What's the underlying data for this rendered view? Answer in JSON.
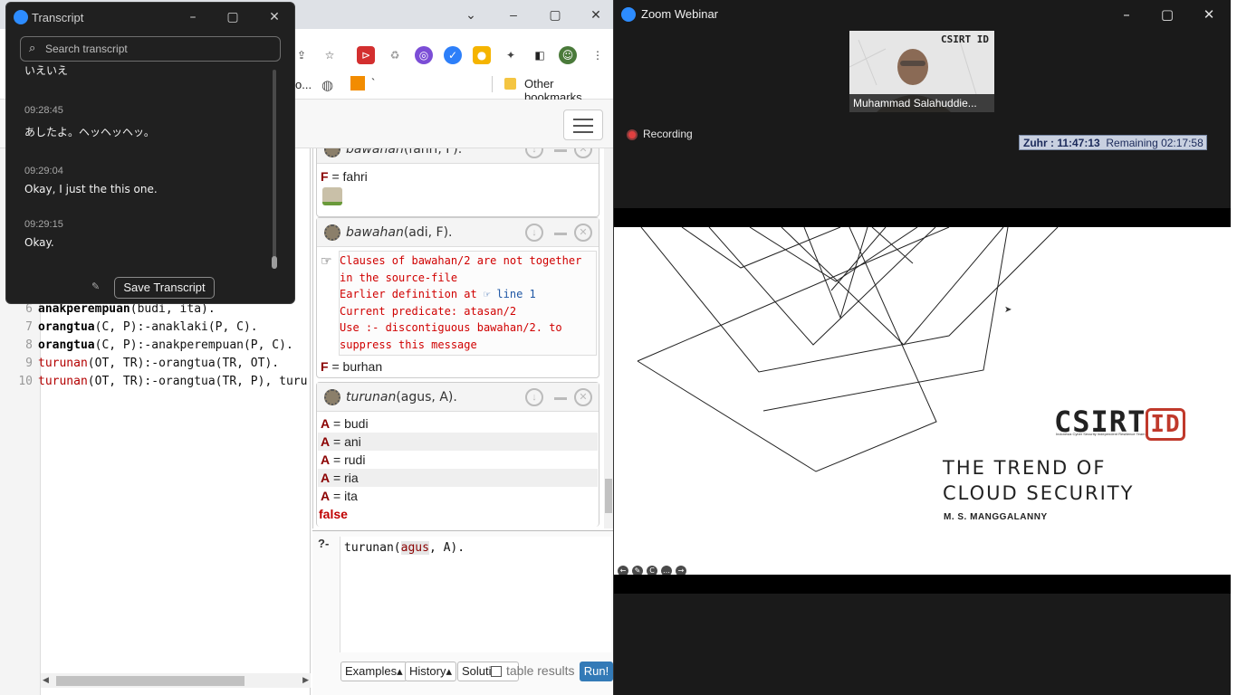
{
  "browser": {
    "bookmarks": {
      "truncated_label": "o...",
      "other_bookmarks": "Other bookmarks",
      "backtick": "`"
    },
    "editor": {
      "lines": [
        {
          "num": "6",
          "tokens": [
            [
              "kw",
              "anakperempuan"
            ],
            [
              "txt",
              "(budi, ita)."
            ]
          ]
        },
        {
          "num": "7",
          "tokens": [
            [
              "kw",
              "orangtua"
            ],
            [
              "txt",
              "(C, P):-anaklaki(P, C)."
            ]
          ]
        },
        {
          "num": "8",
          "tokens": [
            [
              "kw",
              "orangtua"
            ],
            [
              "txt",
              "(C, P):-anakperempuan(P, C)."
            ]
          ]
        },
        {
          "num": "9",
          "tokens": [
            [
              "red",
              "turunan"
            ],
            [
              "txt",
              "(OT, TR):-orangtua(TR, OT)."
            ]
          ]
        },
        {
          "num": "10",
          "tokens": [
            [
              "red",
              "turunan"
            ],
            [
              "txt",
              "(OT, TR):-orangtua(TR, P), turu"
            ]
          ]
        }
      ]
    },
    "results": {
      "q1": {
        "pred": "bawahan",
        "args": "(fahri, F).",
        "answer_var": "F",
        "answer_val": "fahri"
      },
      "q2": {
        "pred": "bawahan",
        "args": "(adi, F).",
        "warning": [
          "Clauses of bawahan/2 are not together in the source-file",
          "Earlier definition at",
          "line 1",
          "Current predicate: atasan/2",
          "Use :- discontiguous bawahan/2. to suppress this message"
        ],
        "answer_var": "F",
        "answer_val": "burhan"
      },
      "q3": {
        "pred": "turunan",
        "args": "(agus, A).",
        "answers": [
          {
            "var": "A",
            "val": "budi"
          },
          {
            "var": "A",
            "val": "ani"
          },
          {
            "var": "A",
            "val": "rudi"
          },
          {
            "var": "A",
            "val": "ria"
          },
          {
            "var": "A",
            "val": "ita"
          }
        ],
        "final": "false"
      }
    },
    "query": {
      "prompt": "?-",
      "text_pre": "turunan(",
      "text_hl": "agus",
      "text_post": ", A).",
      "buttons": {
        "examples": "Examples▴",
        "history": "History▴",
        "solutions": "Soluti",
        "table_results": "table results",
        "run": "Run!"
      }
    }
  },
  "transcript": {
    "title": "Transcript",
    "search_placeholder": "Search transcript",
    "entries": [
      {
        "time": "",
        "text": "いえいえ"
      },
      {
        "time": "09:28:45",
        "text": "あしたよ。ヘッヘッヘッ。"
      },
      {
        "time": "09:29:04",
        "text": "Okay, I just the this one."
      },
      {
        "time": "09:29:15",
        "text": "Okay."
      }
    ],
    "save_button": "Save Transcript"
  },
  "zoom": {
    "title": "Zoom Webinar",
    "participant_name": "Muhammad Salahuddie...",
    "participant_logo": "CSIRT ID",
    "recording_label": "Recording",
    "prayer": {
      "label": "Zuhr : 11:47:13",
      "remaining": "Remaining 02:17:58"
    },
    "slide": {
      "logo_main": "CSIRT",
      "logo_id": "ID",
      "logo_tagline": "Indonesia Cyber Security Independent Resilience Team",
      "title_line1": "THE TREND OF",
      "title_line2": "CLOUD SECURITY",
      "author": "M. S. MANGGALANNY"
    }
  },
  "colors": {
    "zoom_blue": "#2d8cff",
    "run_button": "#337ab7",
    "csirt_red": "#c0392b",
    "recording_red": "#e04040"
  },
  "icons": [
    "zoom-logo-icon",
    "search-icon",
    "minimize-icon",
    "maximize-icon",
    "close-icon",
    "chevron-down-icon",
    "share-icon",
    "star-icon",
    "extensions-icon",
    "sidebar-icon",
    "menu-kebab-icon",
    "globe-icon",
    "folder-icon",
    "hamburger-icon",
    "gear-icon",
    "download-icon",
    "minus-icon",
    "close-circle-icon",
    "hand-point-icon",
    "edit-icon",
    "recording-icon",
    "arrow-left-icon",
    "pen-icon",
    "cc-icon",
    "more-icon",
    "arrow-right-icon"
  ]
}
